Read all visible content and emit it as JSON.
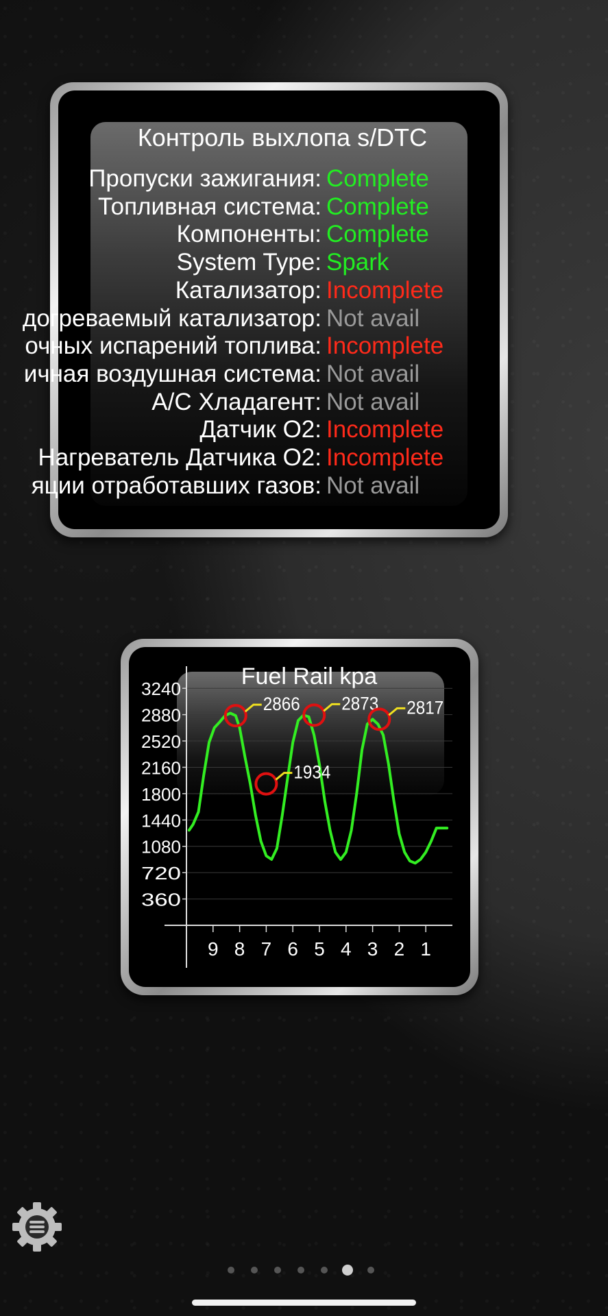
{
  "emission_panel": {
    "title": "Контроль выхлопа s/DTC",
    "rows": [
      {
        "label": "Пропуски зажигания:",
        "value": "Complete",
        "status": "complete"
      },
      {
        "label": "Топливная система:",
        "value": "Complete",
        "status": "complete"
      },
      {
        "label": "Компоненты:",
        "value": "Complete",
        "status": "complete"
      },
      {
        "label": "System Type:",
        "value": "Spark",
        "status": "complete"
      },
      {
        "label": "Катализатор:",
        "value": "Incomplete",
        "status": "incomplete"
      },
      {
        "label": "догреваемый катализатор:",
        "value": "Not avail",
        "status": "na"
      },
      {
        "label": "очных испарений топлива:",
        "value": "Incomplete",
        "status": "incomplete"
      },
      {
        "label": "ичная воздушная система:",
        "value": "Not avail",
        "status": "na"
      },
      {
        "label": "A/C Хладагент:",
        "value": "Not avail",
        "status": "na"
      },
      {
        "label": "Датчик O2:",
        "value": "Incomplete",
        "status": "incomplete"
      },
      {
        "label": "Нагреватель Датчика O2:",
        "value": "Incomplete",
        "status": "incomplete"
      },
      {
        "label": "яции отработавших газов:",
        "value": "Not avail",
        "status": "na"
      }
    ],
    "colors": {
      "complete": "#22ee22",
      "incomplete": "#ff2a1a",
      "na": "#9a9a9a"
    }
  },
  "chart_data": {
    "type": "line",
    "title": "Fuel Rail  kpa",
    "y_ticks": [
      "3240",
      "2880",
      "2520",
      "2160",
      "1800",
      "1440",
      "1080",
      "720",
      "360"
    ],
    "ylim": [
      0,
      3420
    ],
    "x_ticks": [
      "9",
      "8",
      "7",
      "6",
      "5",
      "4",
      "3",
      "2",
      "1"
    ],
    "xlim": [
      10,
      0
    ],
    "line_color": "#33ee22",
    "series": [
      {
        "x": [
          9.9,
          9.75,
          9.55,
          9.35,
          9.15,
          8.95,
          8.75,
          8.55,
          8.35,
          8.15,
          8.0,
          7.8,
          7.6,
          7.4,
          7.2,
          7.0,
          6.8,
          6.6,
          6.4,
          6.2,
          6.0,
          5.8,
          5.6,
          5.4,
          5.2,
          5.0,
          4.8,
          4.6,
          4.4,
          4.2,
          4.0,
          3.8,
          3.6,
          3.4,
          3.2,
          3.0,
          2.8,
          2.6,
          2.4,
          2.2,
          2.0,
          1.8,
          1.6,
          1.4,
          1.2,
          1.0,
          0.8,
          0.6,
          0.4,
          0.2
        ],
        "y": [
          1300,
          1380,
          1550,
          2050,
          2500,
          2700,
          2780,
          2866,
          2900,
          2866,
          2700,
          2300,
          1934,
          1500,
          1150,
          950,
          900,
          1050,
          1500,
          2000,
          2500,
          2800,
          2873,
          2850,
          2600,
          2200,
          1700,
          1300,
          1000,
          900,
          1000,
          1300,
          1800,
          2400,
          2750,
          2817,
          2750,
          2600,
          2200,
          1700,
          1250,
          1000,
          880,
          850,
          900,
          1000,
          1150,
          1330,
          1330,
          1330
        ]
      }
    ],
    "annotations": [
      {
        "x": 8.15,
        "y": 2866,
        "label": "2866"
      },
      {
        "x": 7.0,
        "y": 1934,
        "label": "1934"
      },
      {
        "x": 5.2,
        "y": 2873,
        "label": "2873"
      },
      {
        "x": 2.75,
        "y": 2817,
        "label": "2817"
      }
    ],
    "grid": true
  },
  "icons": {
    "settings": "gear-menu-icon"
  },
  "pager": {
    "count": 7,
    "active_index": 5
  }
}
